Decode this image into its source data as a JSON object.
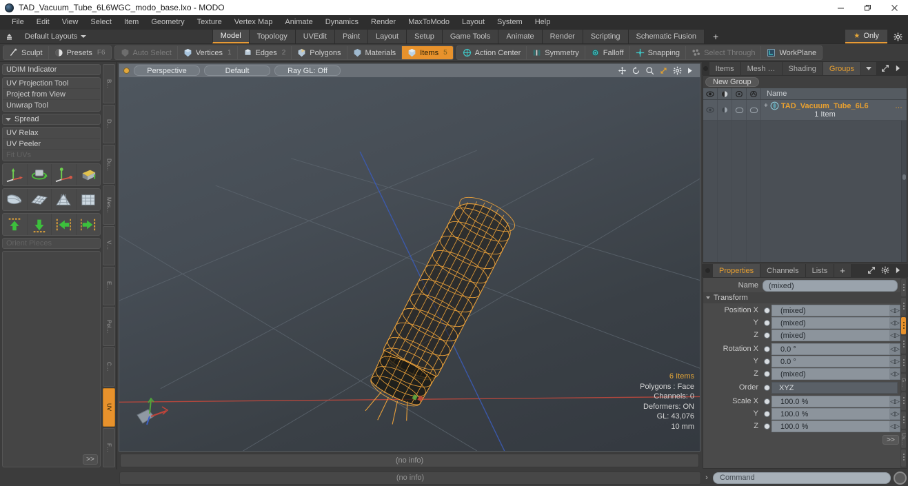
{
  "window": {
    "title": "TAD_Vacuum_Tube_6L6WGC_modo_base.lxo - MODO",
    "minimize": "—",
    "maximize": "❐",
    "close": "✕"
  },
  "menubar": {
    "items": [
      "File",
      "Edit",
      "View",
      "Select",
      "Item",
      "Geometry",
      "Texture",
      "Vertex Map",
      "Animate",
      "Dynamics",
      "Render",
      "MaxToModo",
      "Layout",
      "System",
      "Help"
    ]
  },
  "layoutbar": {
    "layouts_label": "Default Layouts",
    "tabs": [
      {
        "label": "Model",
        "active": true
      },
      {
        "label": "Topology",
        "active": false
      },
      {
        "label": "UVEdit",
        "active": false
      },
      {
        "label": "Paint",
        "active": false
      },
      {
        "label": "Layout",
        "active": false
      },
      {
        "label": "Setup",
        "active": false
      },
      {
        "label": "Game Tools",
        "active": false
      },
      {
        "label": "Animate",
        "active": false
      },
      {
        "label": "Render",
        "active": false
      },
      {
        "label": "Scripting",
        "active": false
      },
      {
        "label": "Schematic Fusion",
        "active": false
      }
    ],
    "add_label": "+",
    "only_label": "Only"
  },
  "modebar": {
    "left_group": [
      {
        "label": "Sculpt",
        "icon": "brush-icon",
        "dim": false,
        "selected": false,
        "badge": ""
      },
      {
        "label": "Presets",
        "icon": "presets-icon",
        "dim": false,
        "selected": false,
        "badge": "F6"
      }
    ],
    "select_group": [
      {
        "label": "Auto Select",
        "icon": "auto-select-icon",
        "dim": true,
        "selected": false,
        "badge": ""
      },
      {
        "label": "Vertices",
        "icon": "vertices-icon",
        "dim": false,
        "selected": false,
        "badge": "1"
      },
      {
        "label": "Edges",
        "icon": "edges-icon",
        "dim": false,
        "selected": false,
        "badge": "2"
      },
      {
        "label": "Polygons",
        "icon": "polygons-icon",
        "dim": false,
        "selected": false,
        "badge": ""
      },
      {
        "label": "Materials",
        "icon": "materials-icon",
        "dim": false,
        "selected": false,
        "badge": ""
      },
      {
        "label": "Items",
        "icon": "items-icon",
        "dim": false,
        "selected": true,
        "badge": "5"
      }
    ],
    "action_group": [
      {
        "label": "Action Center",
        "icon": "action-center-icon",
        "dim": false,
        "selected": false,
        "badge": ""
      },
      {
        "label": "Symmetry",
        "icon": "symmetry-icon",
        "dim": false,
        "selected": false,
        "badge": ""
      },
      {
        "label": "Falloff",
        "icon": "falloff-icon",
        "dim": false,
        "selected": false,
        "badge": ""
      },
      {
        "label": "Snapping",
        "icon": "snapping-icon",
        "dim": false,
        "selected": false,
        "badge": ""
      },
      {
        "label": "Select Through",
        "icon": "select-through-icon",
        "dim": true,
        "selected": false,
        "badge": ""
      },
      {
        "label": "WorkPlane",
        "icon": "workplane-icon",
        "dim": false,
        "selected": false,
        "badge": ""
      }
    ]
  },
  "left_panel": {
    "udim_indicator": "UDIM Indicator",
    "uv_tools": [
      "UV Projection Tool",
      "Project from View",
      "Unwrap Tool"
    ],
    "spread_header": "Spread",
    "relax_tools": [
      "UV Relax",
      "UV Peeler"
    ],
    "fit_uvs": "Fit UVs",
    "orient_pieces": "Orient Pieces",
    "more_label": ">>",
    "vertical_tabs": [
      {
        "label": "B…",
        "active": false
      },
      {
        "label": "D…",
        "active": false
      },
      {
        "label": "Du…",
        "active": false
      },
      {
        "label": "Mes…",
        "active": false
      },
      {
        "label": "V…",
        "active": false
      },
      {
        "label": "E…",
        "active": false
      },
      {
        "label": "Pol…",
        "active": false
      },
      {
        "label": "C…",
        "active": false
      },
      {
        "label": "UV",
        "active": true
      },
      {
        "label": "F…",
        "active": false
      }
    ]
  },
  "viewport": {
    "view_mode": "Perspective",
    "shading": "Default",
    "raygl": "Ray GL: Off",
    "nav_icons": [
      "pan-icon",
      "rotate-icon",
      "zoom-icon",
      "fit-icon",
      "viewport-settings-icon",
      "viewport-menu-arrow-icon"
    ],
    "info": {
      "items": "6 Items",
      "polygons": "Polygons : Face",
      "channels": "Channels: 0",
      "deformers": "Deformers: ON",
      "gl": "GL: 43,076",
      "scale": "10 mm"
    },
    "status": "(no info)"
  },
  "right_top_panel": {
    "tabs": [
      {
        "label": "Items",
        "active": false
      },
      {
        "label": "Mesh …",
        "active": false
      },
      {
        "label": "Shading",
        "active": false
      },
      {
        "label": "Groups",
        "active": true
      }
    ],
    "new_group_label": "New Group",
    "column_headers": [
      "visibility-icon",
      "render-icon",
      "lock-icon",
      "wireframe-icon"
    ],
    "name_header": "Name",
    "rows": [
      {
        "name": "TAD_Vacuum_Tube_6L6",
        "ellipsis": "…",
        "subtitle": "1 Item",
        "icon": "group-item-icon"
      }
    ]
  },
  "properties_panel": {
    "tabs": [
      {
        "label": "Properties",
        "active": true
      },
      {
        "label": "Channels",
        "active": false
      },
      {
        "label": "Lists",
        "active": false
      },
      {
        "label": "+",
        "active": false
      }
    ],
    "name_label": "Name",
    "name_value": "(mixed)",
    "transform_label": "Transform",
    "fields": [
      {
        "label": "Position X",
        "value": "(mixed)",
        "type": "num"
      },
      {
        "label": "Y",
        "value": "(mixed)",
        "type": "num"
      },
      {
        "label": "Z",
        "value": "(mixed)",
        "type": "num"
      },
      {
        "label": "Rotation X",
        "value": "0.0 °",
        "type": "num"
      },
      {
        "label": "Y",
        "value": "0.0 °",
        "type": "num"
      },
      {
        "label": "Z",
        "value": "(mixed)",
        "type": "num"
      },
      {
        "label": "Order",
        "value": "XYZ",
        "type": "select"
      },
      {
        "label": "Scale X",
        "value": "100.0 %",
        "type": "num"
      },
      {
        "label": "Y",
        "value": "100.0 %",
        "type": "num"
      },
      {
        "label": "Z",
        "value": "100.0 %",
        "type": "num"
      }
    ],
    "more_label": ">>",
    "side_tabs": [
      "",
      "",
      "",
      "",
      "G…",
      "",
      "",
      "Us…",
      ""
    ]
  },
  "bottombar": {
    "command_placeholder": "Command",
    "chevron": "›"
  },
  "colors": {
    "accent_orange": "#e8922c",
    "wireframe_orange": "#e9a03a",
    "panel_bg": "#3c3c3c",
    "viewport_bg": "#464d55",
    "axis_x": "#c8443a",
    "axis_y": "#4fa83a",
    "axis_z": "#3a5fc8"
  }
}
